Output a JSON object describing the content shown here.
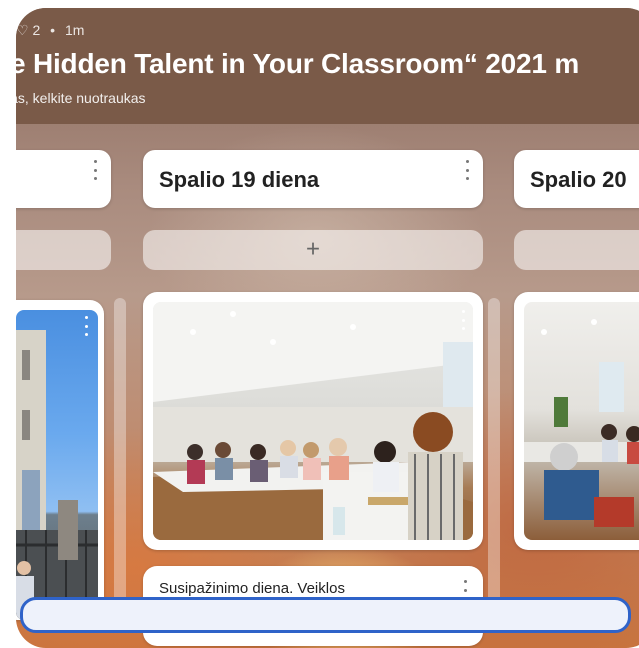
{
  "header": {
    "meta_count": "2",
    "meta_time": "1m",
    "title": "e Hidden Talent in Your Classroom“  2021 m",
    "subtitle": "klas, kelkite nuotraukas"
  },
  "columns": [
    {
      "label": ""
    },
    {
      "label": "Spalio 19 diena"
    },
    {
      "label": "Spalio 20"
    }
  ],
  "posts": {
    "col2_caption": "Susipažinimo diena. Veiklos"
  },
  "colors": {
    "header_bg": "#7a5a48",
    "focus_blue": "#2f63c9"
  }
}
